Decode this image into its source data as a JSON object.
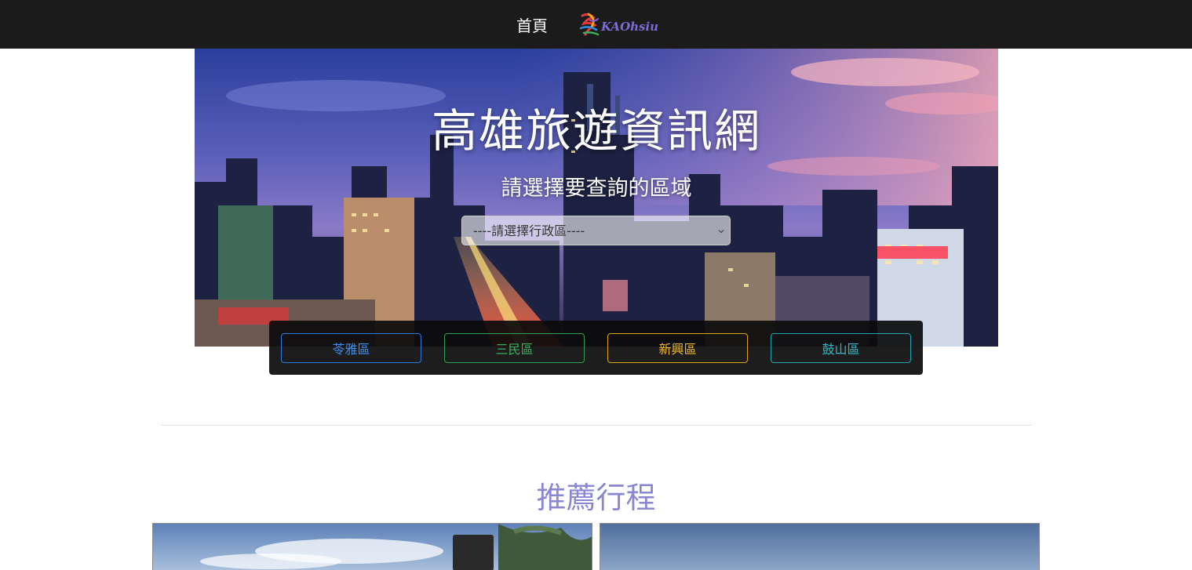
{
  "navbar": {
    "home_label": "首頁",
    "logo_text": "KAOhsiung"
  },
  "hero": {
    "title": "高雄旅遊資訊網",
    "subtitle": "請選擇要查詢的區域",
    "select": {
      "selected": "----請選擇行政區----",
      "options": [
        "----請選擇行政區----"
      ]
    }
  },
  "district_buttons": [
    {
      "label": "苓雅區",
      "color": "#2a7ae2"
    },
    {
      "label": "三民區",
      "color": "#2f9e52"
    },
    {
      "label": "新興區",
      "color": "#e0a31e"
    },
    {
      "label": "鼓山區",
      "color": "#20a7b4"
    }
  ],
  "recommend": {
    "title": "推薦行程",
    "title_color": "#8a86cf"
  },
  "colors": {
    "navbar_bg": "#1b1b1b",
    "button_bar_bg": "#0c0c0c"
  }
}
